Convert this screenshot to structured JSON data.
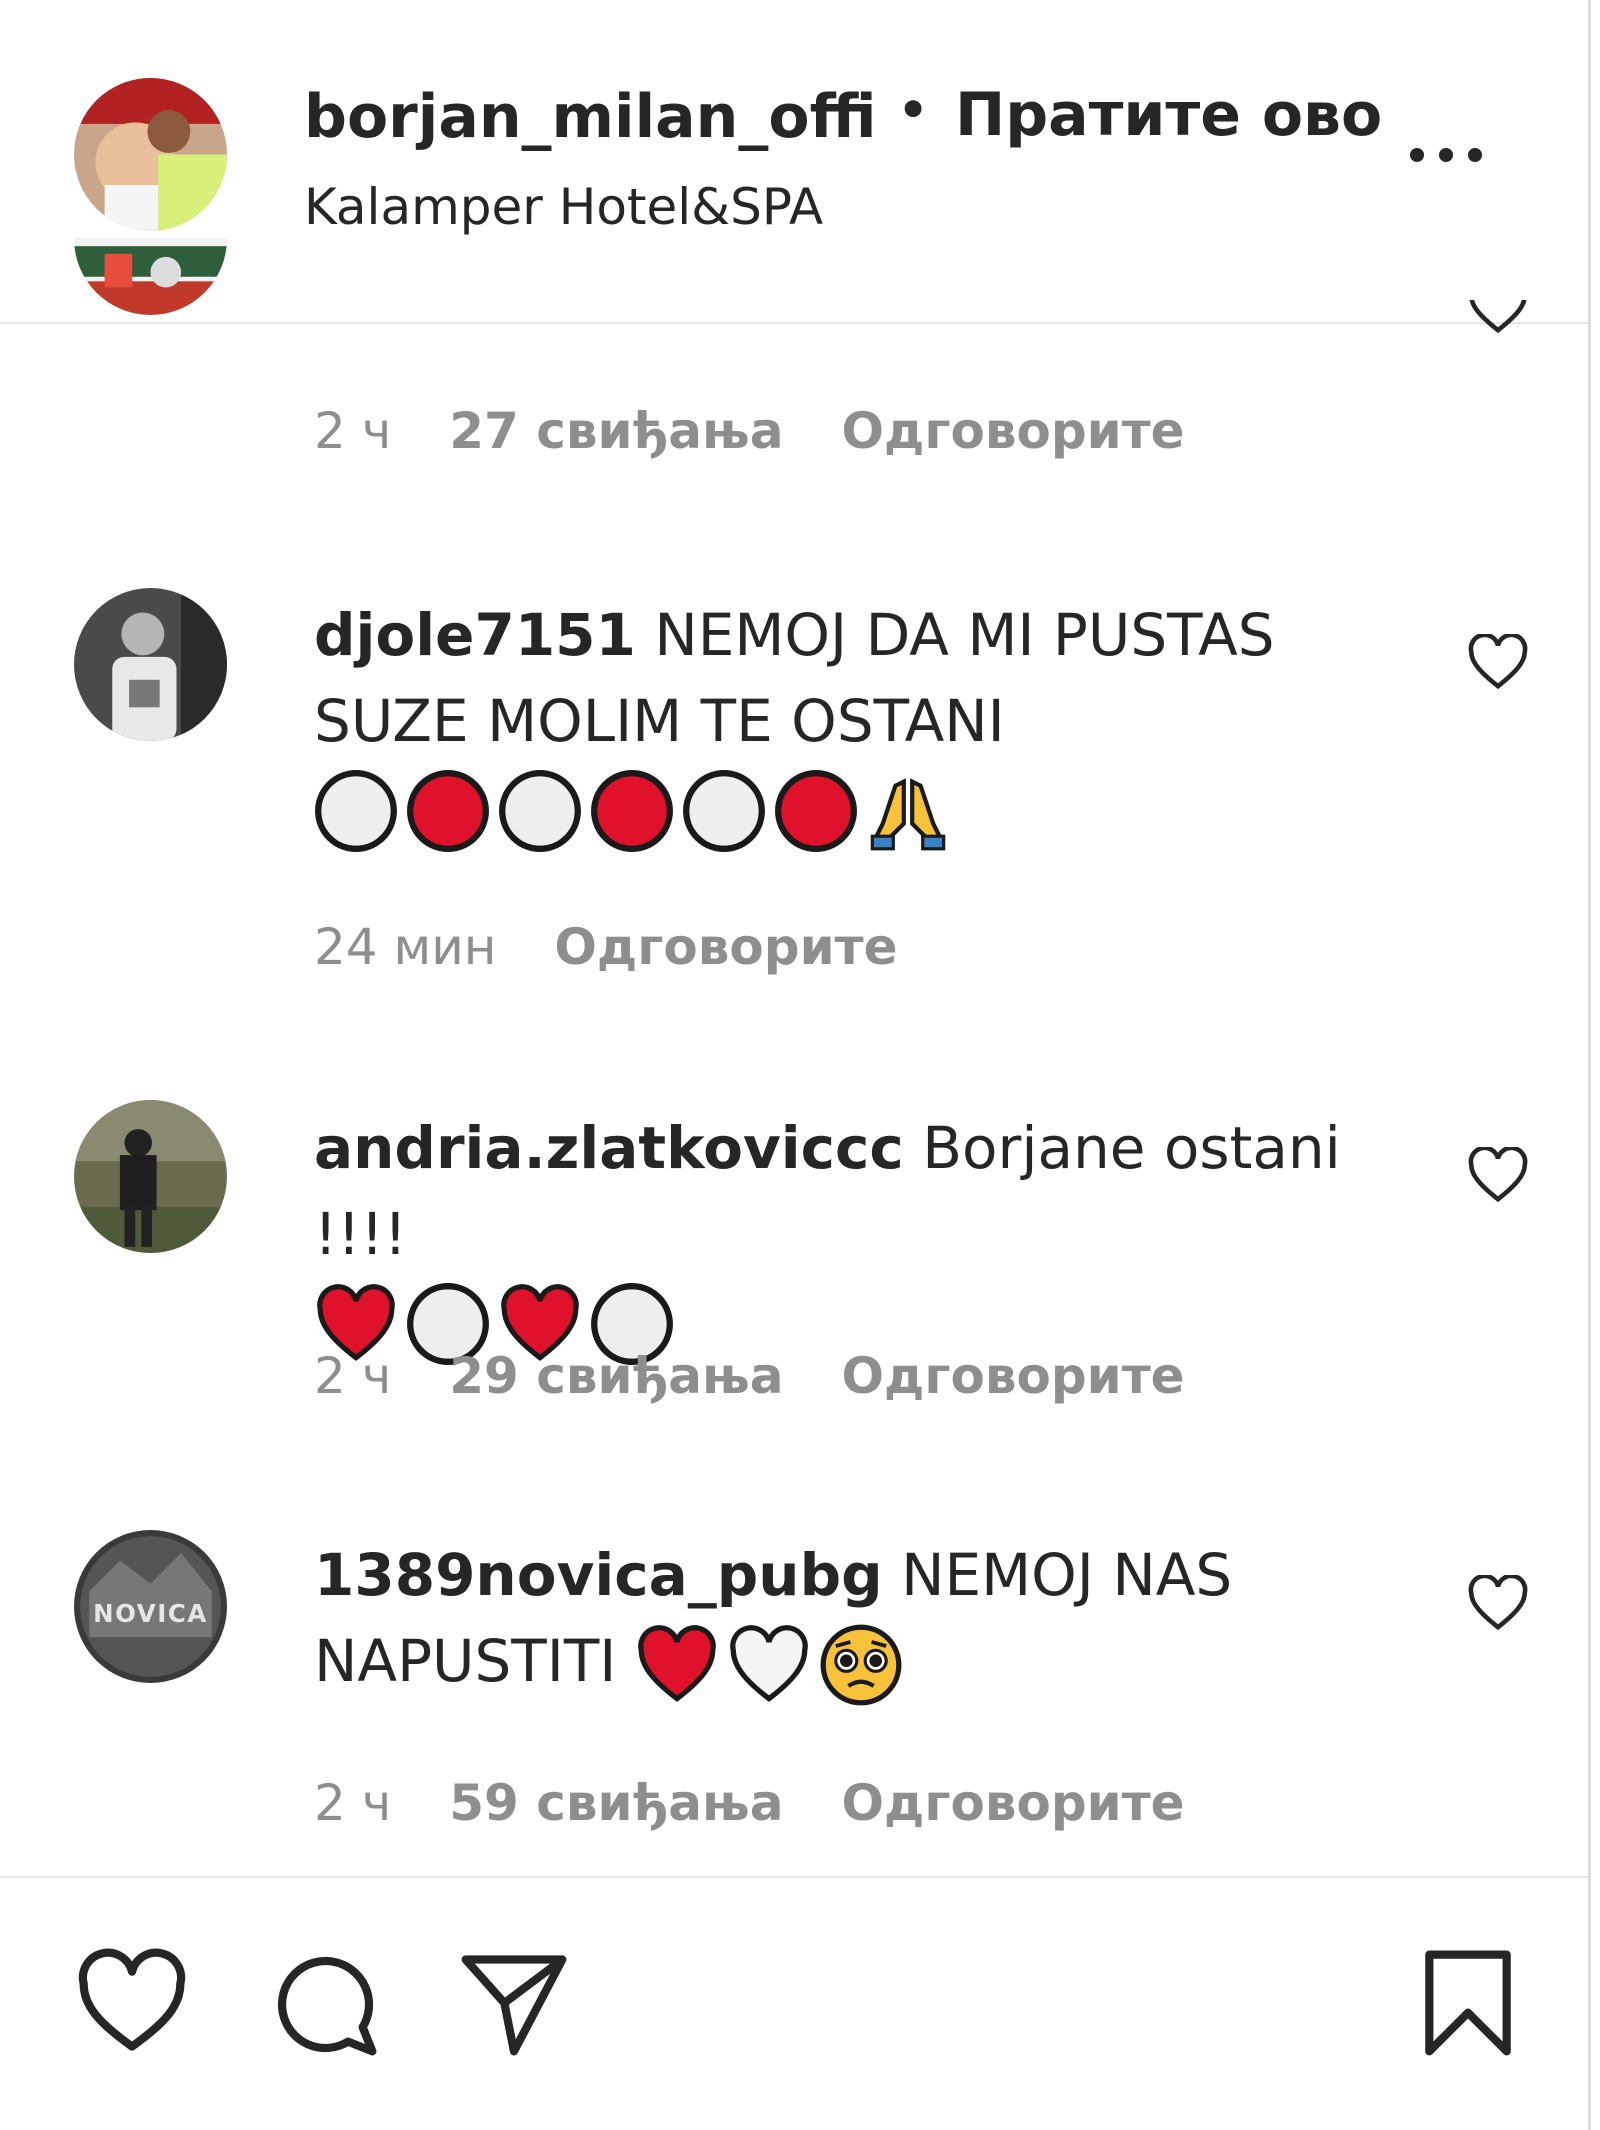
{
  "header": {
    "username": "borjan_milan_offici",
    "separator": "•",
    "follow_label": "Пратите ово",
    "location": "Kalamper Hotel&SPA"
  },
  "first_comment_meta": {
    "time": "2 ч",
    "likes": "27 свиђања",
    "reply": "Одговорите"
  },
  "comments": [
    {
      "username": "djole7151",
      "text": "NEMOJ DA MI PUSTAS SUZE MOLIM TE OSTANI",
      "emojis": [
        "white-circle",
        "red-circle",
        "white-circle",
        "red-circle",
        "white-circle",
        "red-circle",
        "folded-hands"
      ],
      "time": "24 мин",
      "likes": "",
      "reply": "Одговорите"
    },
    {
      "username": "andria.zlatkoviccc",
      "text": "Borjane ostani !!!!",
      "emojis": [
        "red-heart",
        "white-circle",
        "red-heart",
        "white-circle"
      ],
      "time": "2 ч",
      "likes": "29 свиђања",
      "reply": "Одговорите"
    },
    {
      "username": "1389novica_pubg",
      "text": "NEMOJ NAS NAPUSTITI",
      "emojis": [
        "red-heart",
        "white-heart",
        "pleading-face"
      ],
      "time": "2 ч",
      "likes": "59 свиђања",
      "reply": "Одговорите"
    }
  ],
  "avatar_labels": {
    "novica": "NOVICA"
  },
  "actions": {
    "like_icon": "heart-outline-icon",
    "comment_icon": "comment-bubble-icon",
    "share_icon": "paper-plane-icon",
    "save_icon": "bookmark-icon"
  },
  "colors": {
    "text": "#262626",
    "meta": "#8e8e8e",
    "separator": "#e6e6e6",
    "emoji_red": "#e0112b"
  }
}
